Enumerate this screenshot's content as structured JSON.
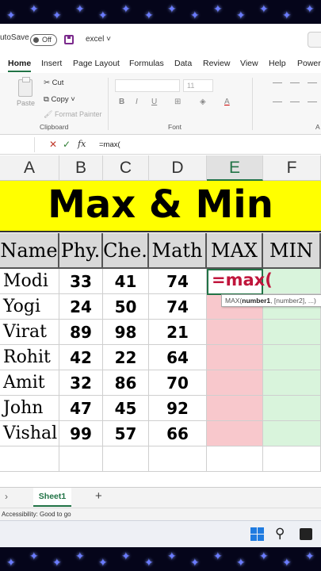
{
  "titlebar": {
    "autosave": "utoSave",
    "toggle": "Off",
    "filename": "excel ˅"
  },
  "tabs": [
    "Home",
    "Insert",
    "Page Layout",
    "Formulas",
    "Data",
    "Review",
    "View",
    "Help",
    "Power"
  ],
  "ribbon": {
    "paste": "Paste",
    "cut": "Cut",
    "copy": "Copy ˅",
    "format_painter": "Format Painter",
    "clipboard": "Clipboard",
    "font": "Font",
    "font_size": "11",
    "align_group": "A"
  },
  "formula_bar": {
    "value": "=max(",
    "fx": "fx"
  },
  "columns": [
    "A",
    "B",
    "C",
    "D",
    "E",
    "F"
  ],
  "title": "Max & Min",
  "headers": [
    "Name",
    "Phy.",
    "Che.",
    "Math",
    "MAX",
    "MIN"
  ],
  "rows": [
    [
      "Modi",
      "33",
      "41",
      "74"
    ],
    [
      "Yogi",
      "24",
      "50",
      "74"
    ],
    [
      "Virat",
      "89",
      "98",
      "21"
    ],
    [
      "Rohit",
      "42",
      "22",
      "64"
    ],
    [
      "Amit",
      "32",
      "86",
      "70"
    ],
    [
      "John",
      "47",
      "45",
      "92"
    ],
    [
      "Vishal",
      "99",
      "57",
      "66"
    ]
  ],
  "active_cell": {
    "value": "=max("
  },
  "tooltip": {
    "fn": "MAX(",
    "arg1": "number1",
    "rest": ", [number2], ...)"
  },
  "sheet": {
    "name": "Sheet1",
    "add": "+"
  },
  "status": "Accessibility: Good to go",
  "colors": {
    "accent": "#217346",
    "title_bg": "#ffff00",
    "max_col": "#f8c8cc",
    "min_col": "#d9f4dc",
    "formula": "#c0163c"
  }
}
